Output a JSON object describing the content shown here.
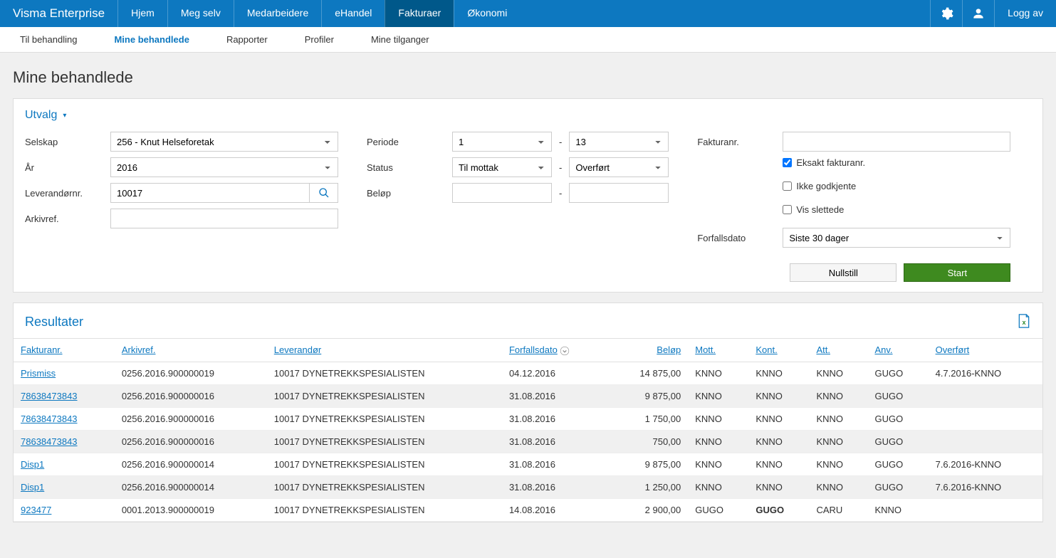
{
  "app": {
    "name": "Visma Enterprise",
    "logoff": "Logg av"
  },
  "topnav": [
    {
      "label": "Hjem"
    },
    {
      "label": "Meg selv"
    },
    {
      "label": "Medarbeidere"
    },
    {
      "label": "eHandel"
    },
    {
      "label": "Fakturaer",
      "active": true
    },
    {
      "label": "Økonomi"
    }
  ],
  "subnav": [
    {
      "label": "Til behandling"
    },
    {
      "label": "Mine behandlede",
      "active": true
    },
    {
      "label": "Rapporter"
    },
    {
      "label": "Profiler"
    },
    {
      "label": "Mine tilganger"
    }
  ],
  "page_title": "Mine behandlede",
  "filters": {
    "panel_title": "Utvalg",
    "selskap_label": "Selskap",
    "selskap_value": "256 - Knut Helseforetak",
    "aar_label": "År",
    "aar_value": "2016",
    "lev_label": "Leverandørnr.",
    "lev_value": "10017",
    "arkiv_label": "Arkivref.",
    "arkiv_value": "",
    "periode_label": "Periode",
    "periode_from": "1",
    "periode_to": "13",
    "status_label": "Status",
    "status_from": "Til mottak",
    "status_to": "Overført",
    "belop_label": "Beløp",
    "belop_from": "",
    "belop_to": "",
    "fakturanr_label": "Fakturanr.",
    "fakturanr_value": "",
    "eksakt_label": "Eksakt fakturanr.",
    "eksakt_checked": true,
    "ikke_label": "Ikke godkjente",
    "ikke_checked": false,
    "vis_label": "Vis slettede",
    "vis_checked": false,
    "forfall_label": "Forfallsdato",
    "forfall_value": "Siste 30 dager",
    "nullstill": "Nullstill",
    "start": "Start"
  },
  "results": {
    "title": "Resultater",
    "headers": {
      "fakturanr": "Fakturanr.",
      "arkivref": "Arkivref.",
      "leverandor": "Leverandør",
      "forfallsdato": "Forfallsdato",
      "belop": "Beløp",
      "mott": "Mott.",
      "kont": "Kont.",
      "att": "Att.",
      "anv": "Anv.",
      "overfort": "Overført"
    },
    "rows": [
      {
        "fakturanr": "Prismiss",
        "arkivref": "0256.2016.900000019",
        "leverandor": "10017 DYNETREKKSPESIALISTEN",
        "forfallsdato": "04.12.2016",
        "belop": "14 875,00",
        "mott": "KNNO",
        "kont": "KNNO",
        "att": "KNNO",
        "anv": "GUGO",
        "overfort": "4.7.2016-KNNO"
      },
      {
        "fakturanr": "78638473843",
        "arkivref": "0256.2016.900000016",
        "leverandor": "10017 DYNETREKKSPESIALISTEN",
        "forfallsdato": "31.08.2016",
        "belop": "9 875,00",
        "mott": "KNNO",
        "kont": "KNNO",
        "att": "KNNO",
        "anv": "GUGO",
        "overfort": ""
      },
      {
        "fakturanr": "78638473843",
        "arkivref": "0256.2016.900000016",
        "leverandor": "10017 DYNETREKKSPESIALISTEN",
        "forfallsdato": "31.08.2016",
        "belop": "1 750,00",
        "mott": "KNNO",
        "kont": "KNNO",
        "att": "KNNO",
        "anv": "GUGO",
        "overfort": ""
      },
      {
        "fakturanr": "78638473843",
        "arkivref": "0256.2016.900000016",
        "leverandor": "10017 DYNETREKKSPESIALISTEN",
        "forfallsdato": "31.08.2016",
        "belop": "750,00",
        "mott": "KNNO",
        "kont": "KNNO",
        "att": "KNNO",
        "anv": "GUGO",
        "overfort": ""
      },
      {
        "fakturanr": "Disp1",
        "arkivref": "0256.2016.900000014",
        "leverandor": "10017 DYNETREKKSPESIALISTEN",
        "forfallsdato": "31.08.2016",
        "belop": "9 875,00",
        "mott": "KNNO",
        "kont": "KNNO",
        "att": "KNNO",
        "anv": "GUGO",
        "overfort": "7.6.2016-KNNO"
      },
      {
        "fakturanr": "Disp1",
        "arkivref": "0256.2016.900000014",
        "leverandor": "10017 DYNETREKKSPESIALISTEN",
        "forfallsdato": "31.08.2016",
        "belop": "1 250,00",
        "mott": "KNNO",
        "kont": "KNNO",
        "att": "KNNO",
        "anv": "GUGO",
        "overfort": "7.6.2016-KNNO"
      },
      {
        "fakturanr": "923477",
        "arkivref": "0001.2013.900000019",
        "leverandor": "10017 DYNETREKKSPESIALISTEN",
        "forfallsdato": "14.08.2016",
        "belop": "2 900,00",
        "mott": "GUGO",
        "kont": "GUGO",
        "kont_bold": true,
        "att": "CARU",
        "anv": "KNNO",
        "overfort": ""
      }
    ]
  }
}
